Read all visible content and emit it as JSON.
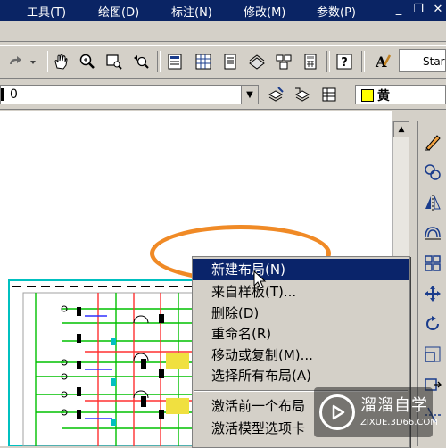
{
  "menubar": {
    "items": [
      {
        "label": "工具(T)"
      },
      {
        "label": "绘图(D)"
      },
      {
        "label": "标注(N)"
      },
      {
        "label": "修改(M)"
      },
      {
        "label": "参数(P)"
      }
    ]
  },
  "toolbar": {
    "text_style_value": "Star"
  },
  "layer": {
    "current": "0",
    "color_label": "黄",
    "color_hex": "#ffff00"
  },
  "context_menu": {
    "items": [
      {
        "label": "新建布局(N)",
        "highlighted": true
      },
      {
        "label": "来自样板(T)..."
      },
      {
        "label": "删除(D)"
      },
      {
        "label": "重命名(R)"
      },
      {
        "label": "移动或复制(M)..."
      },
      {
        "label": "选择所有布局(A)"
      },
      {
        "label": "激活前一个布局"
      },
      {
        "label": "激活模型选项卡"
      }
    ]
  },
  "watermark": {
    "title": "溜溜自学",
    "subtitle": "ZIXUE.3D66.COM"
  },
  "colors": {
    "menubar_bg": "#0a2464",
    "highlight": "#0a246a",
    "annotation_ring": "#f08a26"
  }
}
